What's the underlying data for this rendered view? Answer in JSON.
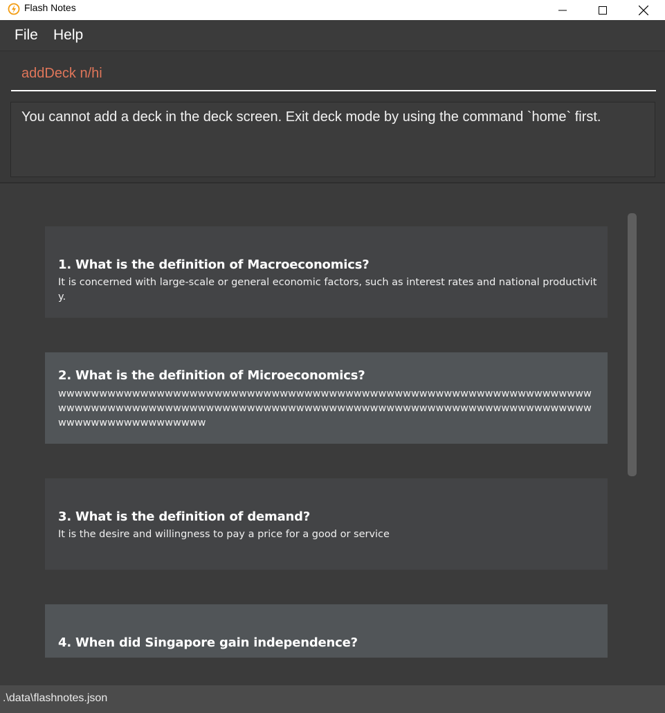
{
  "window": {
    "title": "Flash Notes",
    "icon": "lightning-icon"
  },
  "menu": {
    "items": [
      {
        "label": "File"
      },
      {
        "label": "Help"
      }
    ]
  },
  "command": {
    "value": "addDeck n/hi"
  },
  "result": {
    "message": "You cannot add a deck in the deck screen. Exit deck mode by using the command `home` first."
  },
  "cards": [
    {
      "question": "1.  What is the definition of Macroeconomics?",
      "answer": "It is concerned with large-scale or general economic factors, such as interest rates and national productivity."
    },
    {
      "question": "2.  What is the definition of Microeconomics?",
      "answer": "wwwwwwwwwwwwwwwwwwwwwwwwwwwwwwwwwwwwwwwwwwwwwwwwwwwwwwwwwwwwwwwwwwwwwwwwwwwwwwwwwwwwwwwwwwwwwwwwwwwwwwwwwwwwwwwwwwwwwwwwwwwwwwwwwwwwwwwwwwwwwwwwwwww"
    },
    {
      "question": "3.  What is the definition of demand?",
      "answer": "It is the desire and willingness to pay a price for a good or service"
    },
    {
      "question": "4.  When did Singapore gain independence?",
      "answer": ""
    }
  ],
  "status": {
    "path": ".\\data\\flashnotes.json"
  },
  "colors": {
    "command_text": "#e0765a",
    "background": "#3b3b3b"
  }
}
